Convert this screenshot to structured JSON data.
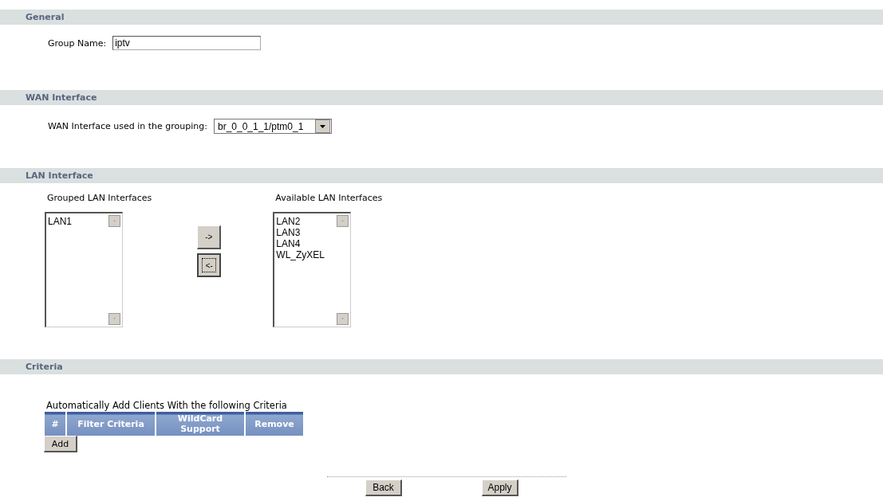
{
  "general": {
    "header": "General",
    "group_name": {
      "label": "Group Name:",
      "value": "iptv"
    }
  },
  "wan": {
    "header": "WAN Interface",
    "label": "WAN Interface used in the grouping:",
    "value": "br_0_0_1_1/ptm0_1"
  },
  "lan": {
    "header": "LAN Interface",
    "grouped": {
      "label": "Grouped LAN Interfaces",
      "items": [
        "LAN1"
      ]
    },
    "available": {
      "label": "Available LAN Interfaces",
      "items": [
        "LAN2",
        "LAN3",
        "LAN4",
        "WL_ZyXEL"
      ]
    },
    "transfer_buttons": [
      {
        "label": "->",
        "focused": false
      },
      {
        "label": "<-",
        "focused": true
      }
    ]
  },
  "criteria": {
    "header": "Criteria",
    "caption": "Automatically Add Clients With the following Criteria",
    "columns": [
      "#",
      "Filter Criteria",
      "WildCard Support",
      "Remove"
    ],
    "add_button": "Add"
  },
  "footer_buttons": [
    "Back",
    "Apply"
  ]
}
